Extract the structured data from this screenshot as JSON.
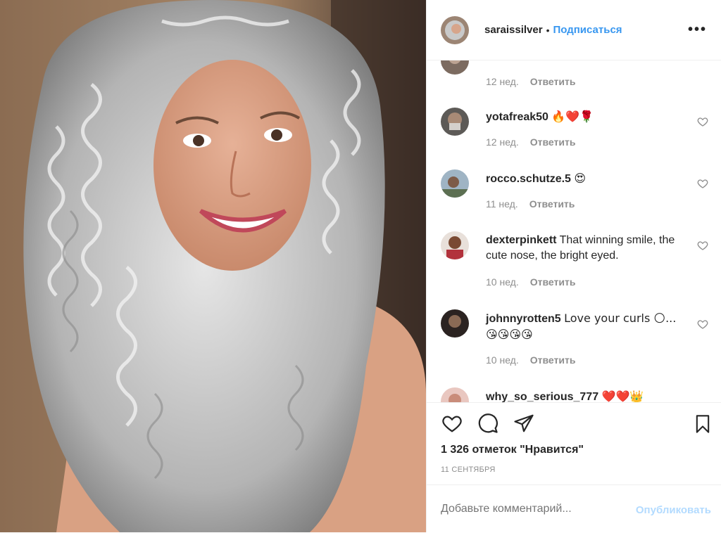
{
  "header": {
    "username": "saraissilver",
    "separator": "•",
    "follow_label": "Подписаться",
    "more_icon": "more-options-icon",
    "more_label": "•••"
  },
  "comments": [
    {
      "username": "",
      "text": "",
      "age": "12 нед.",
      "reply_label": "Ответить",
      "partial": "top"
    },
    {
      "username": "yotafreak50",
      "text": "🔥❤️🌹",
      "age": "12 нед.",
      "reply_label": "Ответить"
    },
    {
      "username": "rocco.schutze.5",
      "text": "😍",
      "age": "11 нед.",
      "reply_label": "Ответить"
    },
    {
      "username": "dexterpinkett",
      "text": "That winning smile, the cute nose, the bright eyed.",
      "age": "10 нед.",
      "reply_label": "Ответить"
    },
    {
      "username": "johnnyrotten5",
      "text": "Love your curls 🌕... 😘😘😘😘",
      "age": "10 нед.",
      "reply_label": "Ответить"
    },
    {
      "username": "why_so_serious_777",
      "text": "❤️❤️👑",
      "partial": "bottom"
    }
  ],
  "actions": {
    "like_icon": "heart-icon",
    "comment_icon": "comment-icon",
    "share_icon": "share-icon",
    "save_icon": "bookmark-icon",
    "likes_text": "1 326 отметок \"Нравится\"",
    "date_text": "11 СЕНТЯБРЯ"
  },
  "add_comment": {
    "placeholder": "Добавьте комментарий...",
    "publish_label": "Опубликовать"
  },
  "colors": {
    "link_blue": "#3897f0",
    "publish_disabled": "#b3dbff",
    "meta_gray": "#8e8e8e",
    "border": "#efefef"
  }
}
